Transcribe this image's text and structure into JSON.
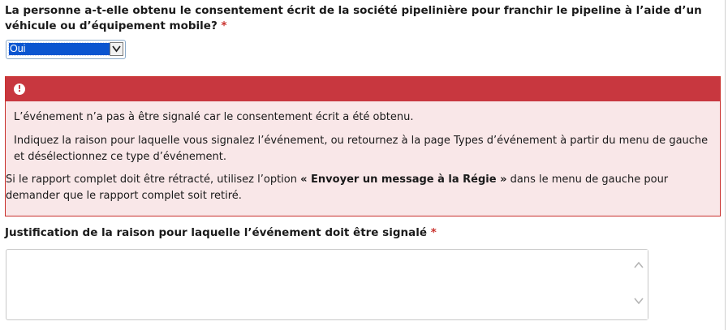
{
  "question": {
    "text": "La personne a-t-elle obtenu le consentement écrit de la société pipelinière pour franchir le pipeline à l’aide d’un véhicule ou d’équipement mobile?",
    "required_marker": "*"
  },
  "consent_select": {
    "selected_value": "Oui"
  },
  "alert": {
    "icon": "exclamation-icon",
    "paragraph1": "L’événement n’a pas à être signalé car le consentement écrit a été obtenu.",
    "paragraph2": "Indiquez la raison pour laquelle vous signalez l’événement, ou retournez à la page Types d’événement à partir du menu de gauche et désélectionnez ce type d’événement.",
    "paragraph3_before": "Si le rapport complet doit être rétracté, utilisez l’option ",
    "paragraph3_bold": "« Envoyer un message à la Régie »",
    "paragraph3_after": " dans le menu de gauche pour demander que le rapport complet soit retiré.",
    "colors": {
      "header": "#c8373f",
      "body": "#f9e7e8",
      "border": "#c9302c"
    }
  },
  "justification": {
    "label": "Justification de la raison pour laquelle l’événement doit être signalé",
    "required_marker": "*",
    "value": ""
  },
  "colors": {
    "required": "#c9302c",
    "select_highlight": "#0a55d0"
  }
}
